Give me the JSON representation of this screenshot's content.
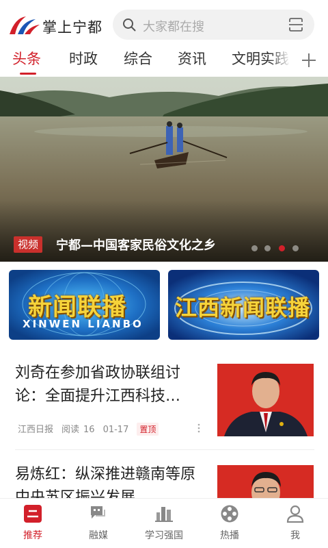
{
  "header": {
    "app_title": "掌上宁都",
    "search_placeholder": "大家都在搜",
    "icons": [
      "logo",
      "search-icon",
      "scan-icon"
    ]
  },
  "tabs": [
    {
      "label": "头条",
      "active": true
    },
    {
      "label": "时政",
      "active": false
    },
    {
      "label": "综合",
      "active": false
    },
    {
      "label": "资讯",
      "active": false
    },
    {
      "label": "文明实践",
      "active": false
    }
  ],
  "banner": {
    "tag": "视频",
    "title": "宁都—中国客家民俗文化之乡",
    "slide_count": 4,
    "active_slide": 3
  },
  "programs": [
    {
      "title": "新闻联播",
      "subtitle": "XINWEN LIANBO"
    },
    {
      "title": "江西新闻联播",
      "subtitle": ""
    }
  ],
  "news": [
    {
      "title": "刘奇在参加省政协联组讨论：全面提升江西科技…",
      "source": "江西日报",
      "reads_label": "阅读",
      "reads": "16",
      "date": "01-17",
      "badge": "置顶"
    },
    {
      "title": "易炼红：纵深推进赣南等原中央苏区振兴发展"
    }
  ],
  "bottom_nav": [
    {
      "label": "推荐",
      "icon": "recommend-icon",
      "active": true
    },
    {
      "label": "融媒",
      "icon": "media-icon",
      "active": false
    },
    {
      "label": "学习强国",
      "icon": "study-icon",
      "active": false
    },
    {
      "label": "热播",
      "icon": "film-reel-icon",
      "active": false
    },
    {
      "label": "我",
      "icon": "user-icon",
      "active": false
    }
  ],
  "colors": {
    "accent": "#d2202a",
    "search_bg": "#f1f1f1",
    "card_blue": "#1c4fa8"
  }
}
